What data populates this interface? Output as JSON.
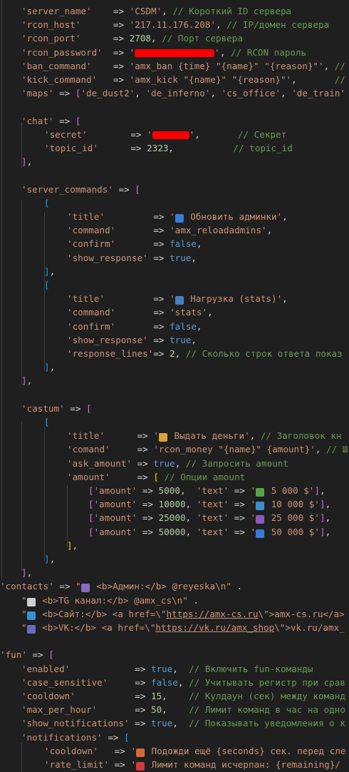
{
  "colors": {
    "background": "#1f1f1f",
    "string": "#ce9178",
    "number": "#b5cea8",
    "keyword": "#569cd6",
    "comment": "#6a9955",
    "bracket_level1": "#ffd700",
    "bracket_level2": "#da70d6",
    "bracket_level3": "#179fff",
    "redaction": "#ff0000"
  },
  "lines": [
    {
      "indent": 30,
      "segs": [
        [
          "key",
          "'server_name'"
        ],
        [
          "op",
          "    => "
        ],
        [
          "str",
          "'CSDM'"
        ],
        [
          "op",
          ", "
        ],
        [
          "cmt",
          "// Короткий ID сервера"
        ]
      ]
    },
    {
      "indent": 30,
      "segs": [
        [
          "key",
          "'rcon_host'"
        ],
        [
          "op",
          "      => "
        ],
        [
          "str",
          "'217.11.176.208'"
        ],
        [
          "op",
          ", "
        ],
        [
          "cmt",
          "// IP/домен сервера"
        ]
      ]
    },
    {
      "indent": 30,
      "segs": [
        [
          "key",
          "'rcon_port'"
        ],
        [
          "op",
          "      => "
        ],
        [
          "num",
          "2708"
        ],
        [
          "op",
          ", "
        ],
        [
          "cmt",
          "// Порт сервера"
        ]
      ]
    },
    {
      "indent": 30,
      "segs": [
        [
          "key",
          "'rcon_password'"
        ],
        [
          "op",
          "  => "
        ],
        [
          "str",
          "'"
        ],
        [
          "red",
          "112"
        ],
        [
          "str",
          "'"
        ],
        [
          "op",
          ", "
        ],
        [
          "cmt",
          "// RCON пароль"
        ]
      ]
    },
    {
      "indent": 30,
      "segs": [
        [
          "key",
          "'ban_command'"
        ],
        [
          "op",
          "    => "
        ],
        [
          "str",
          "'amx_ban {time} \"{name}\" \"{reason}\"'"
        ],
        [
          "op",
          ", "
        ],
        [
          "cmt",
          "//"
        ]
      ]
    },
    {
      "indent": 30,
      "segs": [
        [
          "key",
          "'kick_command'"
        ],
        [
          "op",
          "   => "
        ],
        [
          "str",
          "'amx_kick \"{name}\" \"{reason}\"'"
        ],
        [
          "op",
          ",       "
        ],
        [
          "cmt",
          "//"
        ]
      ]
    },
    {
      "indent": 30,
      "segs": [
        [
          "key",
          "'maps'"
        ],
        [
          "op",
          " => "
        ],
        [
          "br2",
          "["
        ],
        [
          "str",
          "'de_dust2'"
        ],
        [
          "op",
          ", "
        ],
        [
          "str",
          "'de_inferno'"
        ],
        [
          "op",
          ", "
        ],
        [
          "str",
          "'cs_office'"
        ],
        [
          "op",
          ", "
        ],
        [
          "str",
          "'de_train'"
        ]
      ]
    },
    {
      "indent": 30,
      "segs": []
    },
    {
      "indent": 30,
      "segs": [
        [
          "key",
          "'chat'"
        ],
        [
          "op",
          " => "
        ],
        [
          "br2",
          "["
        ]
      ]
    },
    {
      "indent": 62,
      "segs": [
        [
          "key",
          "'secret'"
        ],
        [
          "op",
          "        => "
        ],
        [
          "str",
          "'"
        ],
        [
          "red",
          "52"
        ],
        [
          "str",
          "'"
        ],
        [
          "op",
          ",       "
        ],
        [
          "cmt",
          "// Секрет"
        ]
      ]
    },
    {
      "indent": 62,
      "segs": [
        [
          "key",
          "'topic_id'"
        ],
        [
          "op",
          "      => "
        ],
        [
          "num",
          "2323"
        ],
        [
          "op",
          ",           "
        ],
        [
          "cmt",
          "// topic_id"
        ]
      ]
    },
    {
      "indent": 30,
      "segs": [
        [
          "br2",
          "]"
        ],
        [
          "op",
          ","
        ]
      ]
    },
    {
      "indent": 30,
      "segs": []
    },
    {
      "indent": 30,
      "segs": [
        [
          "key",
          "'server_commands'"
        ],
        [
          "op",
          " => "
        ],
        [
          "br2",
          "["
        ]
      ]
    },
    {
      "indent": 62,
      "segs": [
        [
          "br3",
          "["
        ]
      ]
    },
    {
      "indent": 94,
      "segs": [
        [
          "key",
          "'title'"
        ],
        [
          "op",
          "         => "
        ],
        [
          "str",
          "'"
        ],
        [
          "emo",
          "🛡️",
          "#3a7bd5"
        ],
        [
          "str",
          " Обновить админки'"
        ],
        [
          "op",
          ","
        ]
      ]
    },
    {
      "indent": 94,
      "segs": [
        [
          "key",
          "'command'"
        ],
        [
          "op",
          "       => "
        ],
        [
          "str",
          "'amx_reloadadmins'"
        ],
        [
          "op",
          ","
        ]
      ]
    },
    {
      "indent": 94,
      "segs": [
        [
          "key",
          "'confirm'"
        ],
        [
          "op",
          "       => "
        ],
        [
          "bool",
          "false"
        ],
        [
          "op",
          ","
        ]
      ]
    },
    {
      "indent": 94,
      "segs": [
        [
          "key",
          "'show_response'"
        ],
        [
          "op",
          " => "
        ],
        [
          "bool",
          "true"
        ],
        [
          "op",
          ","
        ]
      ]
    },
    {
      "indent": 62,
      "segs": [
        [
          "br3",
          "]"
        ],
        [
          "op",
          ","
        ]
      ]
    },
    {
      "indent": 62,
      "segs": [
        [
          "br3",
          "["
        ]
      ]
    },
    {
      "indent": 94,
      "segs": [
        [
          "key",
          "'title'"
        ],
        [
          "op",
          "         => "
        ],
        [
          "str",
          "'"
        ],
        [
          "emo",
          "📊",
          "#4a7fc0"
        ],
        [
          "str",
          " Нагрузка (stats)'"
        ],
        [
          "op",
          ","
        ]
      ]
    },
    {
      "indent": 94,
      "segs": [
        [
          "key",
          "'command'"
        ],
        [
          "op",
          "       => "
        ],
        [
          "str",
          "'stats'"
        ],
        [
          "op",
          ","
        ]
      ]
    },
    {
      "indent": 94,
      "segs": [
        [
          "key",
          "'confirm'"
        ],
        [
          "op",
          "       => "
        ],
        [
          "bool",
          "false"
        ],
        [
          "op",
          ","
        ]
      ]
    },
    {
      "indent": 94,
      "segs": [
        [
          "key",
          "'show_response'"
        ],
        [
          "op",
          " => "
        ],
        [
          "bool",
          "true"
        ],
        [
          "op",
          ","
        ]
      ]
    },
    {
      "indent": 94,
      "segs": [
        [
          "key",
          "'response_lines'"
        ],
        [
          "op",
          "=> "
        ],
        [
          "num",
          "2"
        ],
        [
          "op",
          ", "
        ],
        [
          "cmt",
          "// Сколько строк ответа показ"
        ]
      ]
    },
    {
      "indent": 62,
      "segs": [
        [
          "br3",
          "]"
        ],
        [
          "op",
          ","
        ]
      ]
    },
    {
      "indent": 30,
      "segs": [
        [
          "br2",
          "]"
        ],
        [
          "op",
          ","
        ]
      ]
    },
    {
      "indent": 30,
      "segs": []
    },
    {
      "indent": 30,
      "segs": [
        [
          "key",
          "'castum'"
        ],
        [
          "op",
          " => "
        ],
        [
          "br2",
          "["
        ]
      ]
    },
    {
      "indent": 62,
      "segs": [
        [
          "br3",
          "["
        ]
      ]
    },
    {
      "indent": 94,
      "segs": [
        [
          "key",
          "'title'"
        ],
        [
          "op",
          "      => "
        ],
        [
          "str",
          "'"
        ],
        [
          "emo",
          "💰",
          "#d9a23a"
        ],
        [
          "str",
          " Выдать деньги'"
        ],
        [
          "op",
          ", "
        ],
        [
          "cmt",
          "// Заголовок кн"
        ]
      ]
    },
    {
      "indent": 94,
      "segs": [
        [
          "key",
          "'comand'"
        ],
        [
          "op",
          "     => "
        ],
        [
          "str",
          "'rcon_money \"{name}\" {amount}'"
        ],
        [
          "op",
          ", "
        ],
        [
          "cmt",
          "// Ш"
        ]
      ]
    },
    {
      "indent": 94,
      "segs": [
        [
          "key",
          "'ask_amount'"
        ],
        [
          "op",
          " => "
        ],
        [
          "bool",
          "true"
        ],
        [
          "op",
          ", "
        ],
        [
          "cmt",
          "// Запросить amount"
        ]
      ]
    },
    {
      "indent": 94,
      "segs": [
        [
          "key",
          "'amount'"
        ],
        [
          "op",
          "     => "
        ],
        [
          "br1",
          "["
        ],
        [
          "op",
          " "
        ],
        [
          "cmt",
          "// Опции amount"
        ]
      ]
    },
    {
      "indent": 124,
      "segs": [
        [
          "br2",
          "["
        ],
        [
          "key",
          "'amount'"
        ],
        [
          "op",
          " => "
        ],
        [
          "num",
          "5000"
        ],
        [
          "op",
          ",  "
        ],
        [
          "key",
          "'text'"
        ],
        [
          "op",
          " => "
        ],
        [
          "str",
          "'"
        ],
        [
          "emo",
          "💵",
          "#5aa04a"
        ],
        [
          "str",
          " 5 000 $'"
        ],
        [
          "br2",
          "]"
        ],
        [
          "op",
          ","
        ]
      ]
    },
    {
      "indent": 124,
      "segs": [
        [
          "br2",
          "["
        ],
        [
          "key",
          "'amount'"
        ],
        [
          "op",
          " => "
        ],
        [
          "num",
          "10000"
        ],
        [
          "op",
          ", "
        ],
        [
          "key",
          "'text'"
        ],
        [
          "op",
          " => "
        ],
        [
          "str",
          "'"
        ],
        [
          "emo",
          "💶",
          "#3a8fd0"
        ],
        [
          "str",
          " 10 000 $'"
        ],
        [
          "br2",
          "]"
        ],
        [
          "op",
          ","
        ]
      ]
    },
    {
      "indent": 124,
      "segs": [
        [
          "br2",
          "["
        ],
        [
          "key",
          "'amount'"
        ],
        [
          "op",
          " => "
        ],
        [
          "num",
          "25000"
        ],
        [
          "op",
          ", "
        ],
        [
          "key",
          "'text'"
        ],
        [
          "op",
          " => "
        ],
        [
          "str",
          "'"
        ],
        [
          "emo",
          "💷",
          "#8a5ac0"
        ],
        [
          "str",
          " 25 000 $'"
        ],
        [
          "br2",
          "]"
        ],
        [
          "op",
          ","
        ]
      ]
    },
    {
      "indent": 124,
      "segs": [
        [
          "br2",
          "["
        ],
        [
          "key",
          "'amount'"
        ],
        [
          "op",
          " => "
        ],
        [
          "num",
          "50000"
        ],
        [
          "op",
          ", "
        ],
        [
          "key",
          "'text'"
        ],
        [
          "op",
          " => "
        ],
        [
          "str",
          "'"
        ],
        [
          "emo",
          "💳",
          "#3a7bd5"
        ],
        [
          "str",
          " 50 000 $'"
        ],
        [
          "br2",
          "]"
        ],
        [
          "op",
          ","
        ]
      ]
    },
    {
      "indent": 94,
      "segs": [
        [
          "br1",
          "]"
        ],
        [
          "op",
          ","
        ]
      ]
    },
    {
      "indent": 62,
      "segs": [
        [
          "br3",
          "]"
        ],
        [
          "op",
          ","
        ]
      ]
    },
    {
      "indent": 30,
      "segs": [
        [
          "br2",
          "]"
        ],
        [
          "op",
          ","
        ]
      ]
    },
    {
      "indent": 0,
      "segs": [
        [
          "key",
          "'contacts'"
        ],
        [
          "op",
          " => "
        ],
        [
          "str",
          "\""
        ],
        [
          "emo",
          "👤",
          "#8a6ac0"
        ],
        [
          "str",
          " <b>Админ:</b> @reyeska\\n\""
        ],
        [
          "op",
          " ."
        ]
      ]
    },
    {
      "indent": 30,
      "segs": [
        [
          "str",
          "\""
        ],
        [
          "emo",
          "💭",
          "#cfcfcf"
        ],
        [
          "str",
          " <b>TG канал:</b> @amx_cs\\n\""
        ],
        [
          "op",
          " ."
        ]
      ]
    },
    {
      "indent": 30,
      "segs": [
        [
          "str",
          "\""
        ],
        [
          "emo",
          "🌐",
          "#3a8fd0"
        ],
        [
          "str",
          " <b>Сайт:</b> <a href=\\\""
        ],
        [
          "url",
          "https://amx-cs.ru"
        ],
        [
          "str",
          "\\\">amx-cs.ru</a>"
        ]
      ]
    },
    {
      "indent": 30,
      "segs": [
        [
          "str",
          "\""
        ],
        [
          "emo",
          "👥",
          "#6a6ac0"
        ],
        [
          "str",
          " <b>VK:</b> <a href=\\\""
        ],
        [
          "url",
          "https://vk.ru/amx_shop"
        ],
        [
          "str",
          "\\\">vk.ru/amx_"
        ]
      ]
    },
    {
      "indent": 0,
      "segs": []
    },
    {
      "indent": 0,
      "segs": [
        [
          "key",
          "'fun'"
        ],
        [
          "op",
          " => "
        ],
        [
          "br2",
          "["
        ]
      ]
    },
    {
      "indent": 30,
      "segs": [
        [
          "key",
          "'enabled'"
        ],
        [
          "op",
          "            => "
        ],
        [
          "bool",
          "true"
        ],
        [
          "op",
          ",  "
        ],
        [
          "cmt",
          "// Включить fun-команды"
        ]
      ]
    },
    {
      "indent": 30,
      "segs": [
        [
          "key",
          "'case_sensitive'"
        ],
        [
          "op",
          "     => "
        ],
        [
          "bool",
          "false"
        ],
        [
          "op",
          ", "
        ],
        [
          "cmt",
          "// Учитывать регистр при срав"
        ]
      ]
    },
    {
      "indent": 30,
      "segs": [
        [
          "key",
          "'cooldown'"
        ],
        [
          "op",
          "           => "
        ],
        [
          "num",
          "15"
        ],
        [
          "op",
          ",    "
        ],
        [
          "cmt",
          "// Кулдаун (сек) между команд"
        ]
      ]
    },
    {
      "indent": 30,
      "segs": [
        [
          "key",
          "'max_per_hour'"
        ],
        [
          "op",
          "       => "
        ],
        [
          "num",
          "50"
        ],
        [
          "op",
          ",    "
        ],
        [
          "cmt",
          "// Лимит команд в час на одно"
        ]
      ]
    },
    {
      "indent": 30,
      "segs": [
        [
          "key",
          "'show_notifications'"
        ],
        [
          "op",
          " => "
        ],
        [
          "bool",
          "true"
        ],
        [
          "op",
          ",  "
        ],
        [
          "cmt",
          "// Показывать уведомления о к"
        ]
      ]
    },
    {
      "indent": 30,
      "segs": [
        [
          "key",
          "'notifications'"
        ],
        [
          "op",
          " => "
        ],
        [
          "br3",
          "["
        ]
      ]
    },
    {
      "indent": 62,
      "segs": [
        [
          "key",
          "'cooldown'"
        ],
        [
          "op",
          "   => "
        ],
        [
          "str",
          "'"
        ],
        [
          "emo",
          "⏱️",
          "#d06a3a"
        ],
        [
          "str",
          " Подожди ещё {seconds} сек. перед сле"
        ]
      ]
    },
    {
      "indent": 62,
      "segs": [
        [
          "key",
          "'rate_limit'"
        ],
        [
          "op",
          " => "
        ],
        [
          "str",
          "'"
        ],
        [
          "emo",
          "🚫",
          "#d03a3a"
        ],
        [
          "str",
          " Лимит команд исчерпан: {remaining}/"
        ]
      ]
    }
  ]
}
